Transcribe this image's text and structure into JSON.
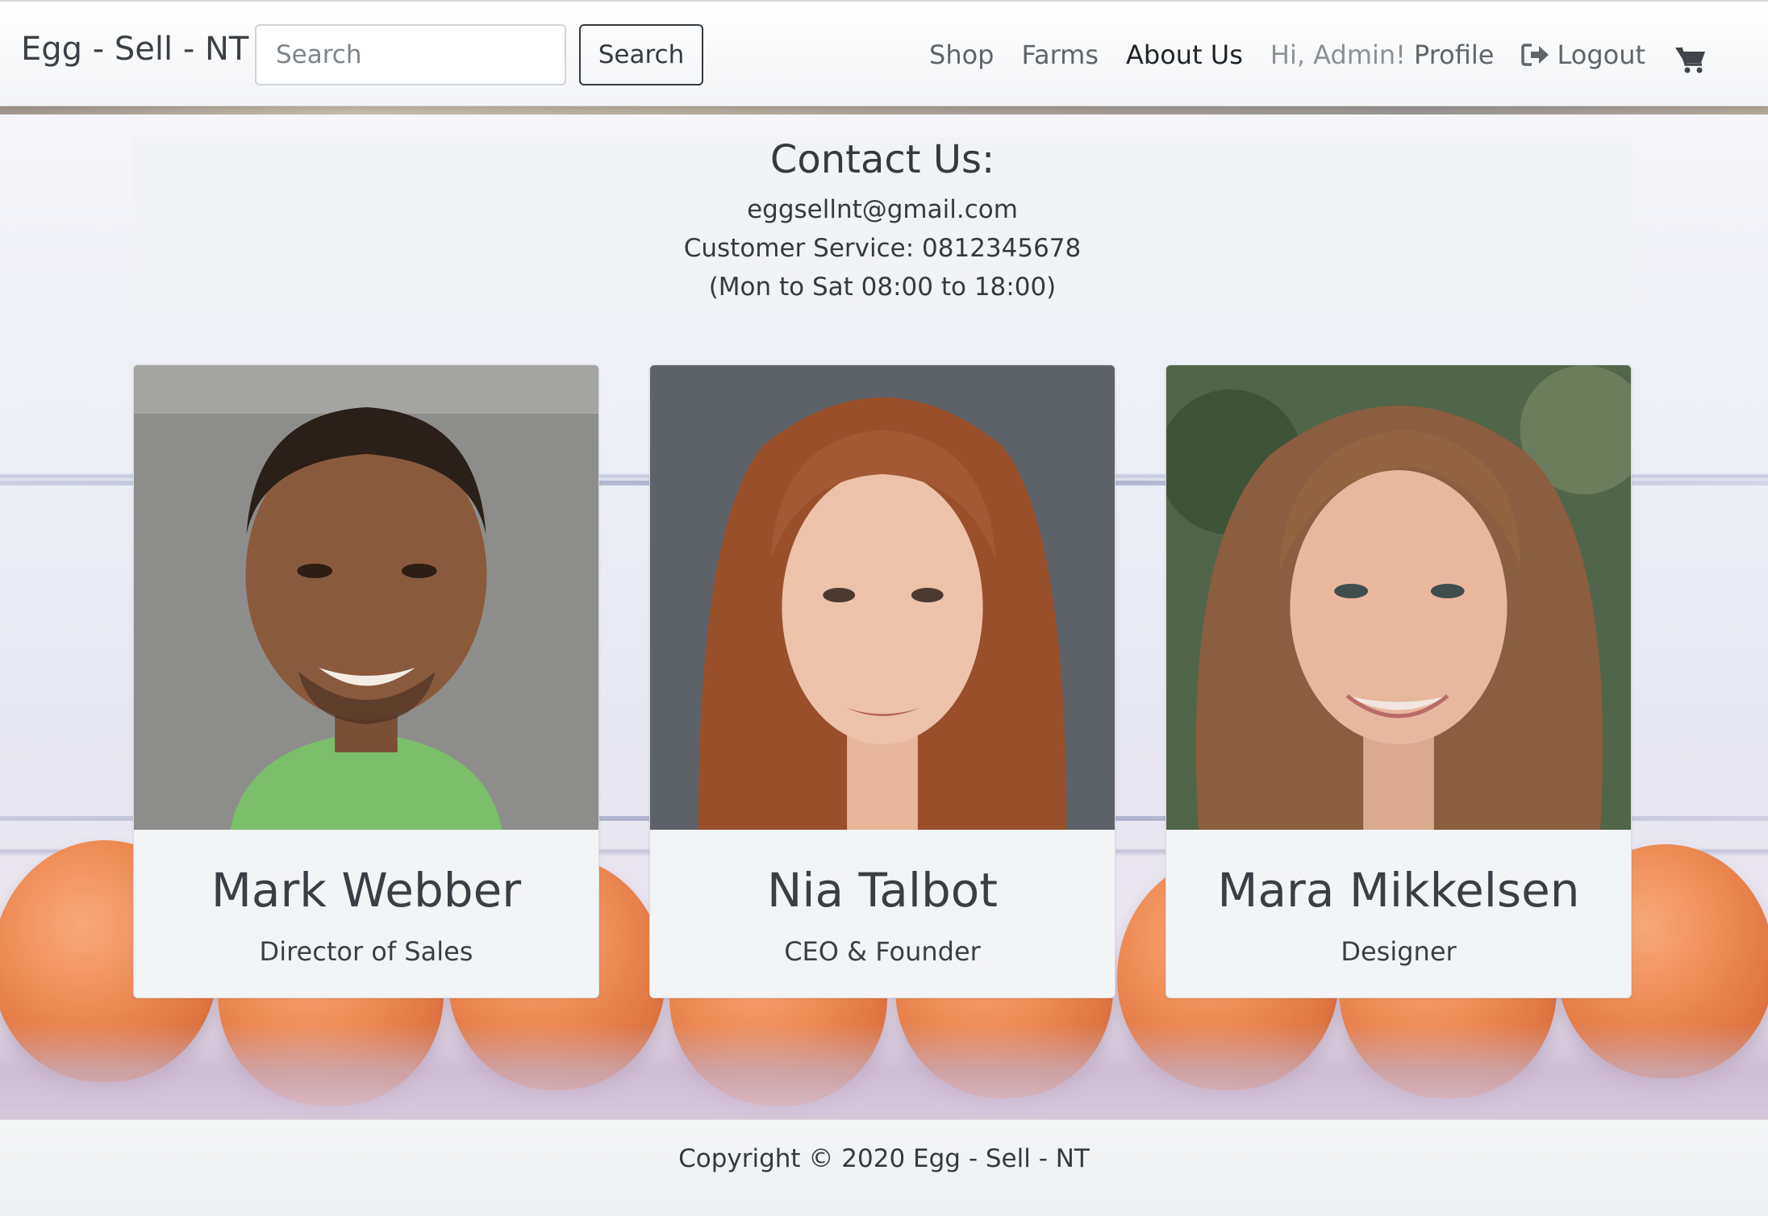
{
  "navbar": {
    "brand": "Egg - Sell - NT",
    "search_placeholder": "Search",
    "search_button": "Search",
    "links": {
      "shop": "Shop",
      "farms": "Farms",
      "about": "About Us"
    },
    "greeting": "Hi, Admin!",
    "profile": "Profile",
    "logout": "Logout",
    "cart_icon": "shopping-cart-icon"
  },
  "contact": {
    "title": "Contact Us:",
    "email": "eggsellnt@gmail.com",
    "phone": "Customer Service: 0812345678",
    "hours": "(Mon to Sat 08:00 to 18:00)"
  },
  "team": [
    {
      "name": "Mark Webber",
      "role": "Director of Sales"
    },
    {
      "name": "Nia Talbot",
      "role": "CEO & Founder"
    },
    {
      "name": "Mara Mikkelsen",
      "role": "Designer"
    }
  ],
  "footer": {
    "copyright": "Copyright © 2020 Egg - Sell - NT"
  },
  "colors": {
    "egg": "#e8804a",
    "panel": "#f2f3f5",
    "text": "#343a40"
  }
}
